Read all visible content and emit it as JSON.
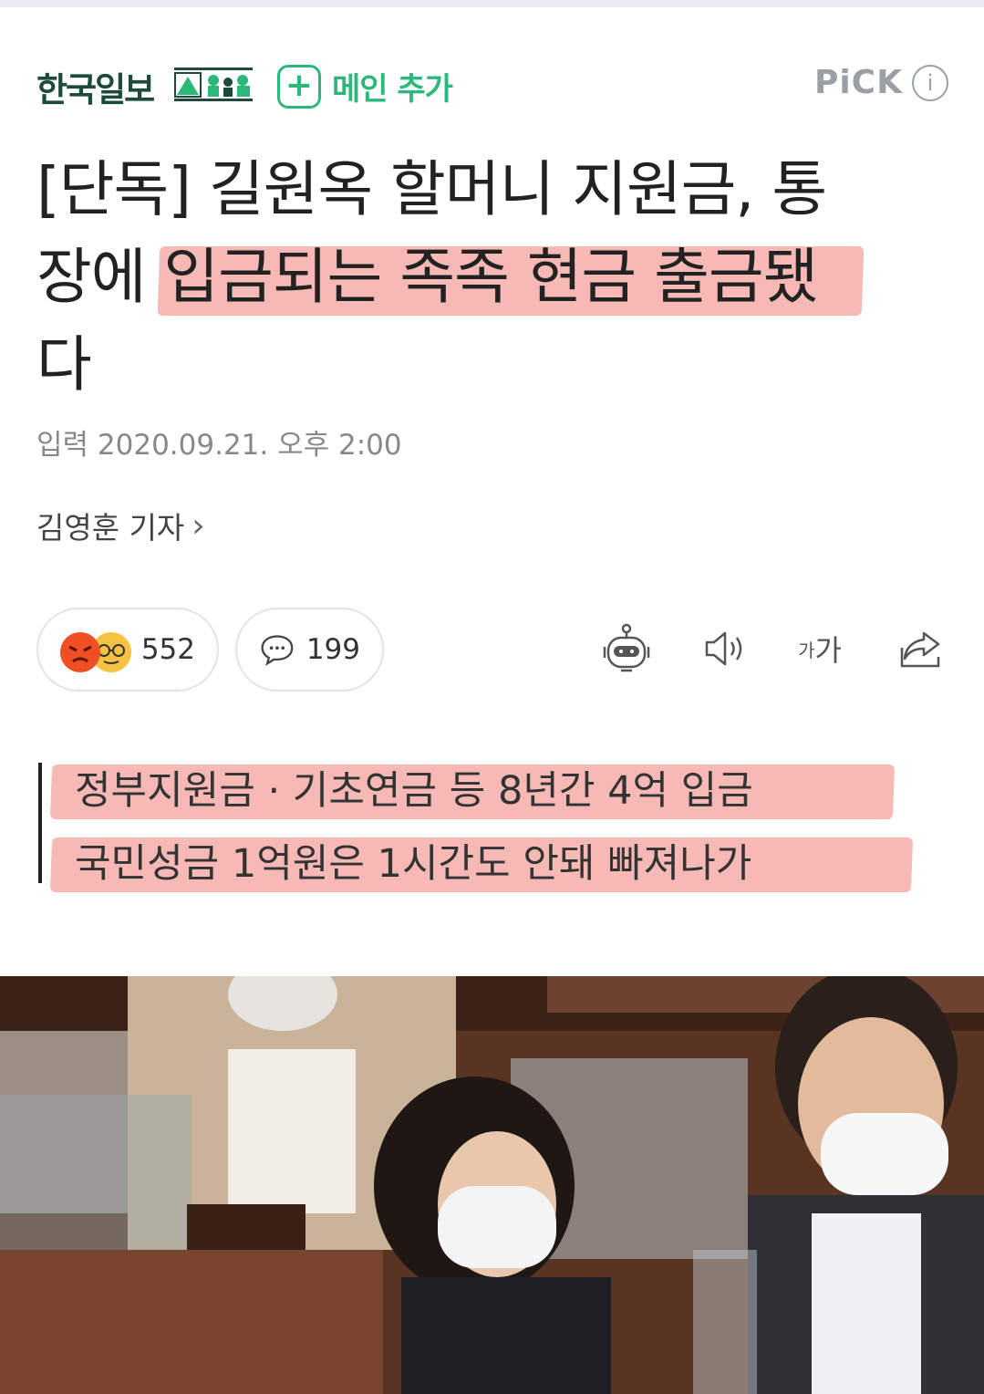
{
  "header": {
    "press_name": "한국일보",
    "add_main_label": "메인 추가",
    "pick_label": "PiCK",
    "info_label": "i"
  },
  "headline": {
    "line1": "[단독] 길원옥 할머니 지원금, 통",
    "line2_pre": "장에 ",
    "line2_highlight": "입금되는 족족 현금 출금",
    "line2_post": "됐",
    "line3": "다"
  },
  "meta": {
    "date": "입력 2020.09.21. 오후 2:00",
    "reporter": "김영훈 기자",
    "reporter_chevron": "›"
  },
  "actions": {
    "reaction_count": "552",
    "comment_count": "199",
    "font_size_small": "가",
    "font_size_large": "가"
  },
  "subheadings": [
    "정부지원금 · 기초연금 등 8년간 4억 입금",
    "국민성금 1억원은 1시간도 안돼 빠져나가"
  ],
  "icons": {
    "reaction": "angry-face-icon",
    "reaction2": "glasses-face-icon",
    "comment": "speech-bubble-icon",
    "summary_bot": "robot-icon",
    "tts": "speaker-icon",
    "share": "share-icon"
  },
  "colors": {
    "accent_green": "#2cb87a",
    "highlight_pink": "#f6b9b5",
    "press_logo": "#1d4a3a",
    "muted_gray": "#9aa0a6"
  }
}
